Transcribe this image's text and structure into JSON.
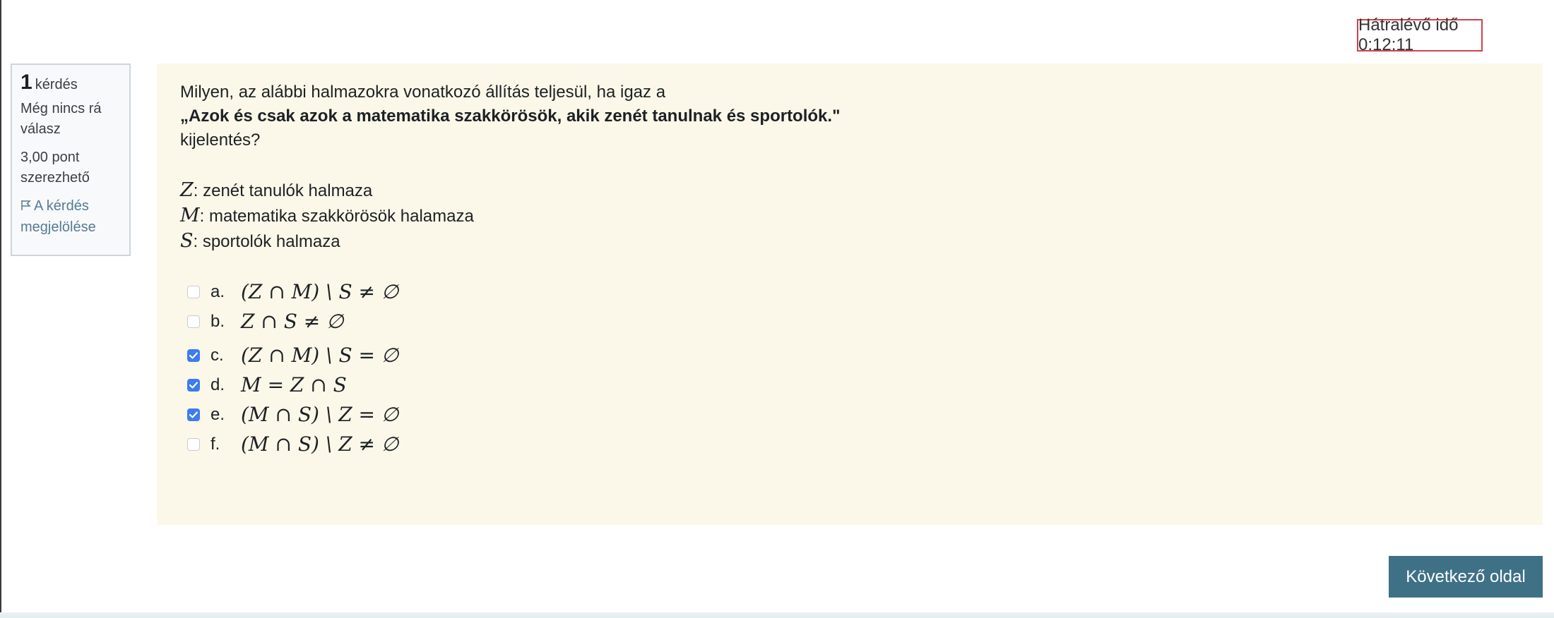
{
  "timer": {
    "text": "Hátralévő idő 0:12:11"
  },
  "info": {
    "number": "1",
    "number_word": "kérdés",
    "state": "Még nincs rá válasz",
    "grade": "3,00 pont szerezhető",
    "flag_label": "A kérdés megjelölése"
  },
  "question": {
    "intro": "Milyen, az alábbi halmazokra vonatkozó állítás teljesül, ha igaz a",
    "statement": "„Azok és csak azok a matematika szakkörösök, akik zenét tanulnak és sportolók.\"",
    "after": "kijelentés?",
    "definitions": [
      {
        "symbol": "Z",
        "text": ": zenét tanulók halmaza"
      },
      {
        "symbol": "M",
        "text": ": matematika szakkörösök halamaza"
      },
      {
        "symbol": "S",
        "text": ": sportolók halmaza"
      }
    ],
    "answers": [
      {
        "letter": "a.",
        "formula": "(Z ∩ M) \\ S ≠ ∅",
        "checked": false
      },
      {
        "letter": "b.",
        "formula": "Z ∩ S ≠ ∅",
        "checked": false
      },
      {
        "letter": "c.",
        "formula": "(Z ∩ M) \\ S = ∅",
        "checked": true
      },
      {
        "letter": "d.",
        "formula": "M = Z ∩ S",
        "checked": true
      },
      {
        "letter": "e.",
        "formula": "(M ∩ S) \\ Z = ∅",
        "checked": true
      },
      {
        "letter": "f.",
        "formula": "(M ∩ S) \\ Z ≠ ∅",
        "checked": false
      }
    ]
  },
  "next_button": {
    "label": "Következő oldal"
  },
  "colors": {
    "accent": "#3f7186",
    "question_bg": "#fcf8e9",
    "timer_border": "#d2404a",
    "checkbox_checked": "#3d7bf0"
  }
}
